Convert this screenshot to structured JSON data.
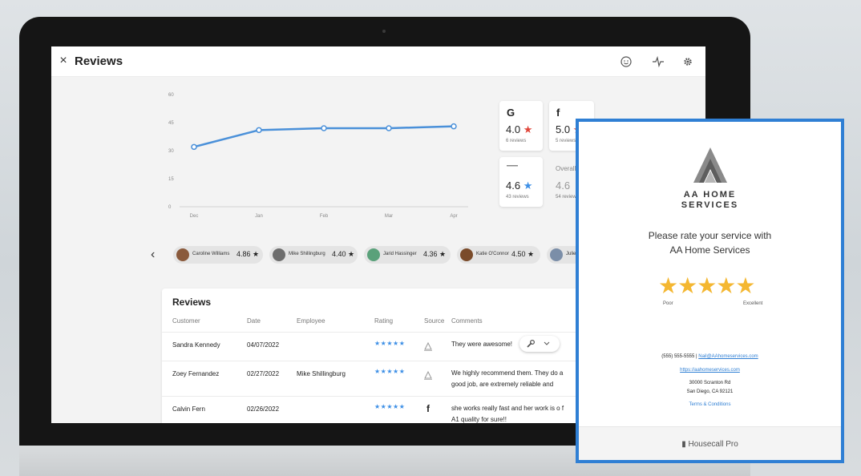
{
  "app": {
    "close_symbol": "×",
    "title": "Reviews",
    "toolbar_icons": [
      "smiley-icon",
      "activity-icon",
      "gear-icon"
    ]
  },
  "chart_data": {
    "type": "line",
    "categories": [
      "Dec",
      "Jan",
      "Feb",
      "Mar",
      "Apr"
    ],
    "values": [
      32,
      41,
      42,
      42,
      43
    ],
    "yticks": [
      0,
      15,
      30,
      45,
      60
    ],
    "ylim": [
      0,
      60
    ],
    "line_color": "#4a90d9"
  },
  "sources": {
    "google": {
      "glyph": "G",
      "rating": "4.0",
      "count": "6 reviews",
      "star_color": "#e0463a"
    },
    "facebook": {
      "glyph": "f",
      "rating": "5.0",
      "count": "5 reviews"
    },
    "aa": {
      "rating": "4.6",
      "count": "43 reviews",
      "star_color": "#3d8fe6"
    },
    "overall": {
      "title": "Overall",
      "rating": "4.6",
      "count": "54 reviews"
    }
  },
  "employees": [
    {
      "name": "Caroline Williams",
      "score": "4.86 ★"
    },
    {
      "name": "Mike Shillingburg",
      "score": "4.40 ★"
    },
    {
      "name": "Jarid Hassinger",
      "score": "4.36 ★"
    },
    {
      "name": "Katie O'Connor",
      "score": "4.50 ★"
    },
    {
      "name": "Julie",
      "score": ""
    }
  ],
  "reviews": {
    "title": "Reviews",
    "columns": [
      "Customer",
      "Date",
      "Employee",
      "Rating",
      "Source",
      "Comments"
    ],
    "rows": [
      {
        "customer": "Sandra Kennedy",
        "date": "04/07/2022",
        "employee": "",
        "rating": "★★★★★",
        "source": "aa-logo-icon",
        "comment": "They were awesome!"
      },
      {
        "customer": "Zoey Fernandez",
        "date": "02/27/2022",
        "employee": "Mike Shillingburg",
        "rating": "★★★★★",
        "source": "aa-logo-icon",
        "comment": "We highly recommend them. They do a good job, are extremely reliable and"
      },
      {
        "customer": "Calvin Fern",
        "date": "02/26/2022",
        "employee": "",
        "rating": "★★★★★",
        "source": "facebook-icon",
        "comment": "she works really fast and her work is o f A1 quality for sure!!"
      }
    ]
  },
  "rating_card": {
    "brand_line1": "AA HOME",
    "brand_line2": "SERVICES",
    "prompt_line1": "Please rate your service with",
    "prompt_line2": "AA Home Services",
    "stars": "★★★★★",
    "poor_label": "Poor",
    "excellent_label": "Excellent",
    "phone": "(555) 555-5555",
    "separator": " | ",
    "email": "Nail@AAhomeservices.com",
    "website": "https://aahomeservices.com",
    "address1": "30000 Scranton Rd",
    "address2": "San Diego, CA 92121",
    "terms": "Terms & Conditions",
    "footer_brand": "Housecall Pro",
    "border_color": "#2f7fd4",
    "star_color": "#f4b731"
  }
}
